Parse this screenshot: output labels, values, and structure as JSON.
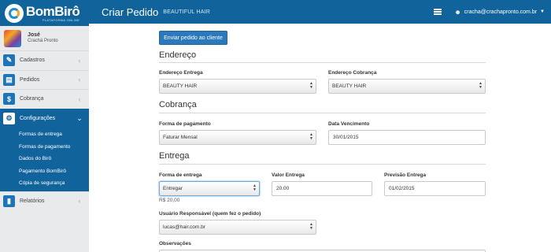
{
  "brand": {
    "name": "BomBirô",
    "tagline": "PLATAFORMA ONLINE"
  },
  "user": {
    "name": "José",
    "company": "Crachá Pronto"
  },
  "sidebar": {
    "items": [
      {
        "label": "Cadastros",
        "icon": "pencil-icon"
      },
      {
        "label": "Pedidos",
        "icon": "document-icon"
      },
      {
        "label": "Cobrança",
        "icon": "dollar-icon"
      },
      {
        "label": "Configurações",
        "icon": "gears-icon"
      },
      {
        "label": "Relatórios",
        "icon": "bar-chart-icon"
      }
    ],
    "submenu": [
      "Formas de entrega",
      "Formas de pagamento",
      "Dados do Birô",
      "Pagamento BomBirô",
      "Cópia de segurança"
    ]
  },
  "topbar": {
    "title": "Criar Pedido",
    "subtitle": "BEAUTIFUL HAIR",
    "email": "cracha@crachapronto.com.br"
  },
  "main": {
    "send_button": "Enviar pedido ao cliente",
    "endereco": {
      "title": "Endereço",
      "entrega_label": "Endereço Entrega",
      "entrega_value": "BEAUTY HAIR",
      "cobranca_label": "Endereço Cobrança",
      "cobranca_value": "BEAUTY HAIR"
    },
    "cobranca": {
      "title": "Cobrança",
      "forma_label": "Forma de pagamento",
      "forma_value": "Faturar Mensal",
      "vencimento_label": "Data Vencimento",
      "vencimento_value": "30/01/2015"
    },
    "entrega": {
      "title": "Entrega",
      "forma_label": "Forma de entrega",
      "forma_value": "Entregar",
      "forma_price": "R$ 20,00",
      "valor_label": "Valor Entrega",
      "valor_value": "20.00",
      "previsao_label": "Previsão Entrega",
      "previsao_value": "01/02/2015",
      "usuario_label": "Usuário Responsável (quem fez o pedido)",
      "usuario_value": "lucas@hair.com.br",
      "observacoes_label": "Observações"
    }
  },
  "colors": {
    "primary": "#11639c",
    "button": "#2b78bb",
    "sidebar_bg": "#e9eaec"
  }
}
